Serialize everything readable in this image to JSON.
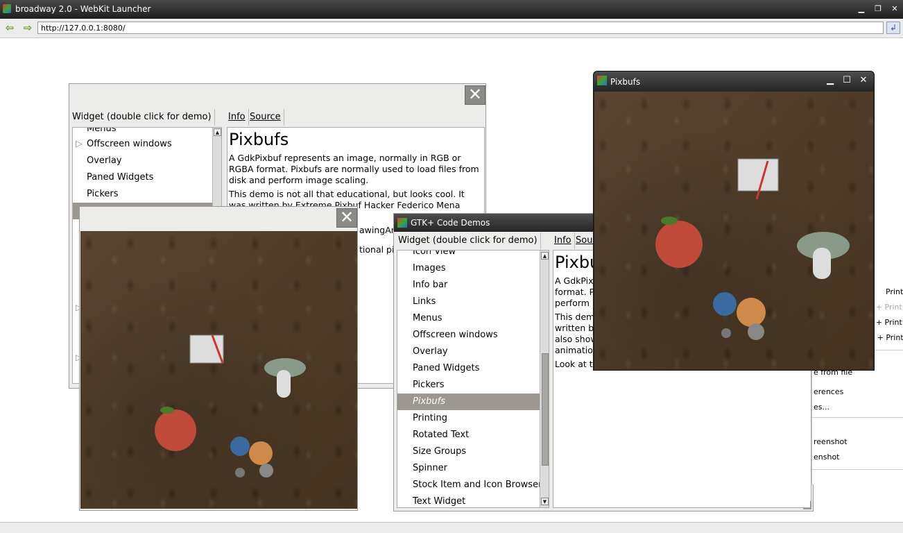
{
  "launcher": {
    "title": "broadway 2.0 - WebKit Launcher",
    "url": "http://127.0.0.1:8080/",
    "minimize": "▁",
    "restore": "❐",
    "close": "✕",
    "back": "⇦",
    "forward": "⇨",
    "go": "↲"
  },
  "back_demo": {
    "close": "✕",
    "tabs": [
      "Widget (double click for demo)",
      "Info",
      "Source"
    ],
    "list": [
      "Menus",
      "Offscreen windows",
      "Overlay",
      "Paned Widgets",
      "Pickers"
    ],
    "info_title": "Pixbufs",
    "info_p1": "A GdkPixbuf represents an image, normally in RGB or RGBA format. Pixbufs are normally used to load files from disk and perform image scaling.",
    "info_p2": "This demo is not all that educational, but looks cool. It was written by Extreme Pixbuf Hacker Federico Mena Quintero. It",
    "info_p2b": "awingAre",
    "info_p3": "tional pix"
  },
  "pixbuf_left": {
    "close": "✕"
  },
  "gtk_demo": {
    "title": "GTK+ Code Demos",
    "tabs": [
      "Widget (double click for demo)",
      "Info",
      "Sourc"
    ],
    "list_top_partial": "Icon View",
    "list": [
      "Images",
      "Info bar",
      "Links",
      "Menus",
      "Offscreen windows",
      "Overlay",
      "Paned Widgets",
      "Pickers",
      "Pixbufs",
      "Printing",
      "Rotated Text",
      "Size Groups",
      "Spinner",
      "Stock Item and Icon Browser",
      "Text Widget"
    ],
    "selected": "Pixbufs",
    "info_title": "Pixbu",
    "info_lines": [
      "A GdkPixb",
      "format. Pi",
      "perform i"
    ],
    "info_lines2": [
      "This demo",
      "written by",
      "also show",
      "animation"
    ],
    "info_last": "Look at th"
  },
  "pixbuf_window": {
    "title": "Pixbufs",
    "minimize": "▁",
    "maximize": "☐",
    "close": "✕"
  },
  "right_menu": {
    "items": [
      "Print",
      "t + Print",
      "t + Print",
      "ll + Print",
      "e from file",
      "erences",
      "es...",
      "reenshot",
      "enshot"
    ]
  }
}
